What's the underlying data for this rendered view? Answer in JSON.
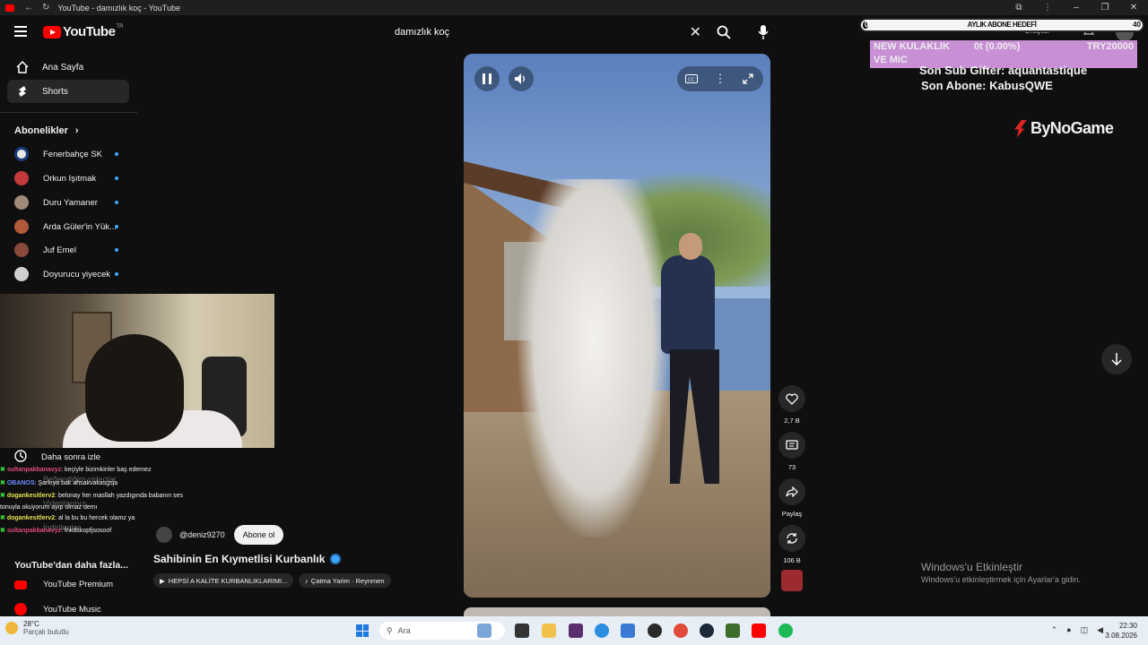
{
  "browser": {
    "window_title": "YouTube - damızlık koç - YouTube"
  },
  "header": {
    "logo_text": "YouTube",
    "logo_region": "TR",
    "search_value": "damızlık koç"
  },
  "sidebar": {
    "items": [
      {
        "label": "Ana Sayfa",
        "icon": "home-icon"
      },
      {
        "label": "Shorts",
        "icon": "shorts-icon"
      }
    ],
    "subscriptions_heading": "Abonelikler",
    "subscriptions": [
      {
        "name": "Fenerbahçe SK",
        "color": "#e8e8e8"
      },
      {
        "name": "Orkun Işıtmak",
        "color": "#c33a3a"
      },
      {
        "name": "Duru Yamaner",
        "color": "#a08a7a"
      },
      {
        "name": "Arda Güler'in Yük...",
        "color": "#b05a3a"
      },
      {
        "name": "Juf Emel",
        "color": "#8a4a3a"
      },
      {
        "name": "Doyurucu yiyecek",
        "color": "#d0d0d0"
      }
    ],
    "watch_later": "Daha sonra izle",
    "ghost_items": [
      "Beğendiğim videolar",
      "Videolarınız",
      "İndirilenler"
    ],
    "more_heading": "YouTube'dan daha fazla...",
    "more": [
      {
        "label": "YouTube Premium"
      },
      {
        "label": "YouTube Music"
      }
    ]
  },
  "chat": [
    {
      "user": "sultanpakbanavyz",
      "text": ": keçiyle bizimkinler baş edemez",
      "user_class": "u1"
    },
    {
      "user": "OBANOS",
      "text": ": Şarkıya bak ahsakvakasgsja",
      "user_class": "u2"
    },
    {
      "user": "dogankesitlerv2",
      "text": ": belonay her masllah yazdıgında babanın ses",
      "user_class": "u3"
    },
    {
      "user": "",
      "text": "tonuyla okuyorum ayıp olmaz demı",
      "user_class": ""
    },
    {
      "user": "dogankesitlerv2",
      "text": ": al la bu bu hercek olamz ya",
      "user_class": "u4"
    },
    {
      "user": "sultanpakbanavyz",
      "text": ": fnkdskopfjsosoof",
      "user_class": "u1"
    }
  ],
  "video": {
    "channel_handle": "@deniz9270",
    "subscribe_label": "Abone ol",
    "title": "Sahibinin En Kıymetlisi Kurbanlık",
    "chips": [
      "HEPSİ A KALİTE KURBANLIKLARIMI...",
      "Çatma Yarim · Reynmen"
    ]
  },
  "actions": [
    {
      "icon": "like-icon",
      "label": "2,7 B"
    },
    {
      "icon": "comment-icon",
      "label": "73"
    },
    {
      "icon": "share-icon",
      "label": "Paylaş"
    },
    {
      "icon": "remix-icon",
      "label": "106 B"
    }
  ],
  "overlay": {
    "goal_text": "AYLIK ABONE HEDEFİ",
    "goal_start": "0",
    "goal_end": "40",
    "ghost_create": "Oluştur",
    "pink_line1_left": "NEW KULAKLIK",
    "pink_line1_mid": "0t (0.00%)",
    "pink_line1_right": "TRY20000",
    "pink_line2": "VE MIC",
    "last_sub_gifter": "Son Sub Gifter: aquantastique",
    "last_subscriber": "Son Abone: KabusQWE",
    "sponsor": "ByNoGame"
  },
  "windows": {
    "activate_title": "Windows'u Etkinleştir",
    "activate_sub": "Windows'u etkinleştirmek için Ayarlar'a gidin.",
    "weather_temp": "28°C",
    "weather_desc": "Parçalı bulutlu",
    "search_placeholder": "Ara",
    "time": "22:30",
    "date": "3.08.2026"
  }
}
